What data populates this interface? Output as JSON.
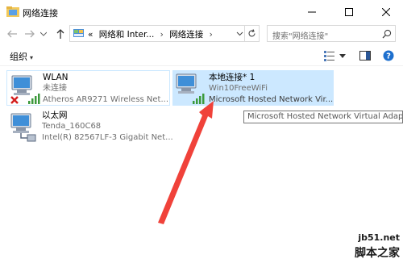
{
  "window": {
    "title": "网络连接",
    "min_icon": "minimize-icon",
    "max_icon": "maximize-icon",
    "close_icon": "close-icon"
  },
  "nav": {
    "back_icon": "back-arrow-icon",
    "forward_icon": "forward-arrow-icon",
    "recent_icon": "chevron-down-icon",
    "up_icon": "up-arrow-icon",
    "breadcrumbs": [
      "«",
      "网络和 Inter...",
      "›",
      "网络连接",
      "›"
    ],
    "refresh_icon": "refresh-icon",
    "search_placeholder": "搜索\"网络连接\""
  },
  "toolbar": {
    "organize_label": "组织",
    "organize_arrow": "▾"
  },
  "connections": [
    {
      "name": "WLAN",
      "status": "未连接",
      "device": "Atheros AR9271 Wireless Net...",
      "icon": "wireless-adapter-disconnected-icon"
    },
    {
      "name": "本地连接* 1",
      "status": "Win10FreeWiFi",
      "device": "Microsoft Hosted Network Vir...",
      "icon": "wireless-adapter-connected-icon",
      "selected": true
    },
    {
      "name": "以太网",
      "status": "Tenda_160C68",
      "device": "Intel(R) 82567LF-3 Gigabit Net...",
      "icon": "ethernet-adapter-icon"
    }
  ],
  "tooltip": "Microsoft Hosted Network Virtual Adapter",
  "annotation": {
    "arrow_color": "#f0423a"
  },
  "watermark": {
    "line1": "jb51.net",
    "line2": "脚本之家"
  }
}
